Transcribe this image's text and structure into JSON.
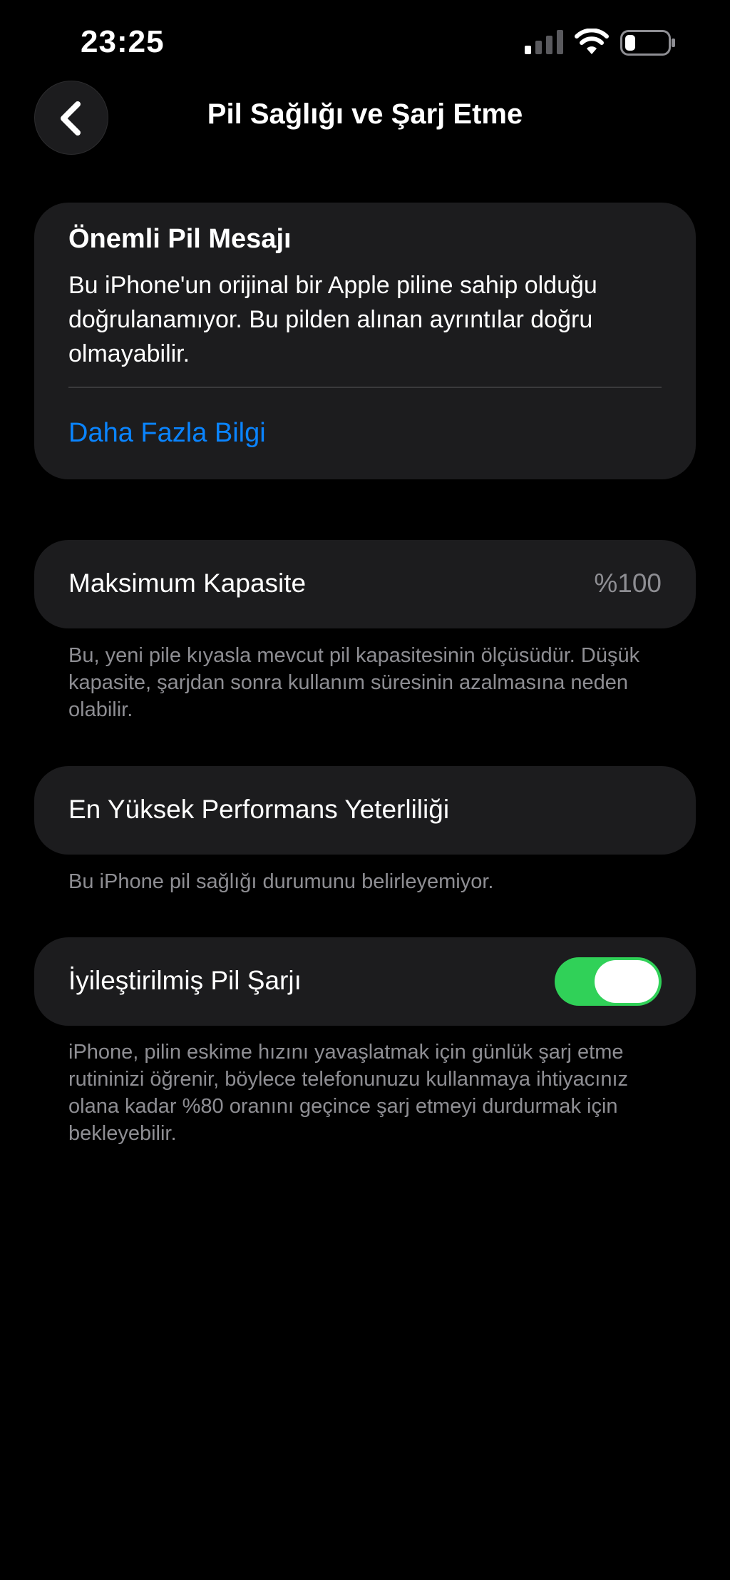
{
  "status_bar": {
    "time": "23:25",
    "signal_icon": "cellular-signal-icon",
    "wifi_icon": "wifi-icon",
    "battery_icon": "battery-icon"
  },
  "nav": {
    "back_icon": "chevron-left-icon",
    "title": "Pil Sağlığı ve Şarj Etme"
  },
  "alert": {
    "title": "Önemli Pil Mesajı",
    "body": "Bu iPhone'un orijinal bir Apple piline sahip olduğu doğrulanamıyor. Bu pilden alınan ayrıntılar doğru olmayabilir.",
    "link": "Daha Fazla Bilgi"
  },
  "capacity": {
    "label": "Maksimum Kapasite",
    "value": "%100",
    "footnote": "Bu, yeni pile kıyasla mevcut pil kapasitesinin ölçüsüdür. Düşük kapasite, şarjdan sonra kullanım süresinin azalmasına neden olabilir."
  },
  "performance": {
    "label": "En Yüksek Performans Yeterliliği",
    "footnote": "Bu iPhone pil sağlığı durumunu belirleyemiyor."
  },
  "optimized_charging": {
    "label": "İyileştirilmiş Pil Şarjı",
    "enabled": true,
    "footnote": "iPhone, pilin eskime hızını yavaşlatmak için günlük şarj etme rutininizi öğrenir, böylece telefonunuzu kullanmaya ihtiyacınız olana kadar %80 oranını geçince şarj etmeyi durdurmak için bekleyebilir."
  },
  "colors": {
    "background": "#000000",
    "card": "#1c1c1e",
    "link": "#0a84ff",
    "toggle_on": "#30d158",
    "secondary_text": "#8e8e93"
  }
}
